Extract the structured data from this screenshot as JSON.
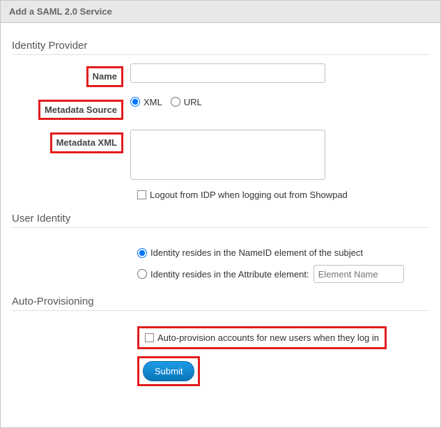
{
  "title": "Add a SAML 2.0 Service",
  "sections": {
    "idp": {
      "heading": "Identity Provider",
      "name_label": "Name",
      "name_value": "",
      "metadata_source_label": "Metadata Source",
      "metadata_source_options": {
        "xml": "XML",
        "url": "URL"
      },
      "metadata_source_selected": "xml",
      "metadata_xml_label": "Metadata XML",
      "metadata_xml_value": "",
      "logout_label": "Logout from IDP when logging out from Showpad",
      "logout_checked": false
    },
    "user_identity": {
      "heading": "User Identity",
      "option_nameid": "Identity resides in the NameID element of the subject",
      "option_attribute": "Identity resides in the Attribute element:",
      "attribute_placeholder": "Element Name",
      "selected": "nameid"
    },
    "auto_provisioning": {
      "heading": "Auto-Provisioning",
      "checkbox_label": "Auto-provision accounts for new users when they log in",
      "checked": false
    },
    "submit_label": "Submit"
  }
}
